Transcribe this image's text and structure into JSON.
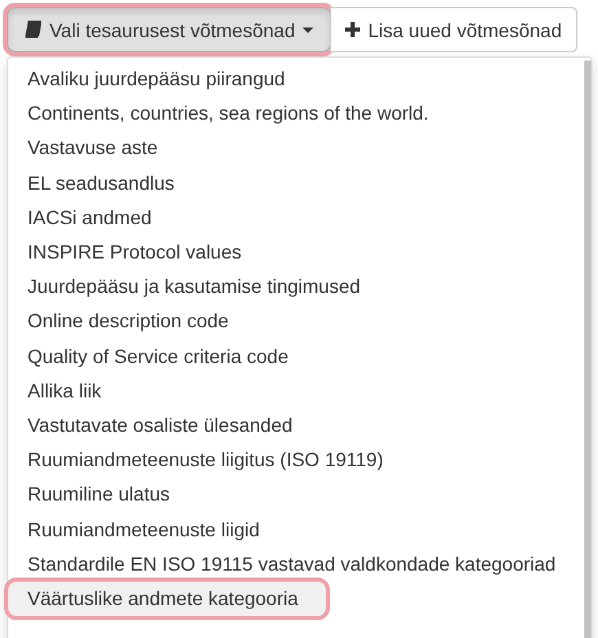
{
  "toolbar": {
    "buttons": [
      {
        "kind": "dropdown",
        "label": "Vali tesaurusest võtmesõnad",
        "pressed": true,
        "highlighted": true
      },
      {
        "kind": "add",
        "label": "Lisa uued võtmesõnad",
        "pressed": false,
        "highlighted": false
      }
    ]
  },
  "menu": {
    "items": [
      {
        "label": "Avaliku juurdepääsu piirangud",
        "selected": false,
        "highlighted": false
      },
      {
        "label": "Continents, countries, sea regions of the world.",
        "selected": false,
        "highlighted": false
      },
      {
        "label": "Vastavuse aste",
        "selected": false,
        "highlighted": false
      },
      {
        "label": "EL seadusandlus",
        "selected": false,
        "highlighted": false
      },
      {
        "label": "IACSi andmed",
        "selected": false,
        "highlighted": false
      },
      {
        "label": "INSPIRE Protocol values",
        "selected": false,
        "highlighted": false
      },
      {
        "label": "Juurdepääsu ja kasutamise tingimused",
        "selected": false,
        "highlighted": false
      },
      {
        "label": "Online description code",
        "selected": false,
        "highlighted": false
      },
      {
        "label": "Quality of Service criteria code",
        "selected": false,
        "highlighted": false
      },
      {
        "label": "Allika liik",
        "selected": false,
        "highlighted": false
      },
      {
        "label": "Vastutavate osaliste ülesanded",
        "selected": false,
        "highlighted": false
      },
      {
        "label": "Ruumiandmeteenuste liigitus (ISO 19119)",
        "selected": false,
        "highlighted": false
      },
      {
        "label": "Ruumiline ulatus",
        "selected": false,
        "highlighted": false
      },
      {
        "label": "Ruumiandmeteenuste liigid",
        "selected": false,
        "highlighted": false
      },
      {
        "label": "Standardile EN ISO 19115 vastavad valdkondade kategooriad",
        "selected": false,
        "highlighted": false
      },
      {
        "label": "Väärtuslike andmete kategooria",
        "selected": true,
        "highlighted": true
      }
    ]
  }
}
